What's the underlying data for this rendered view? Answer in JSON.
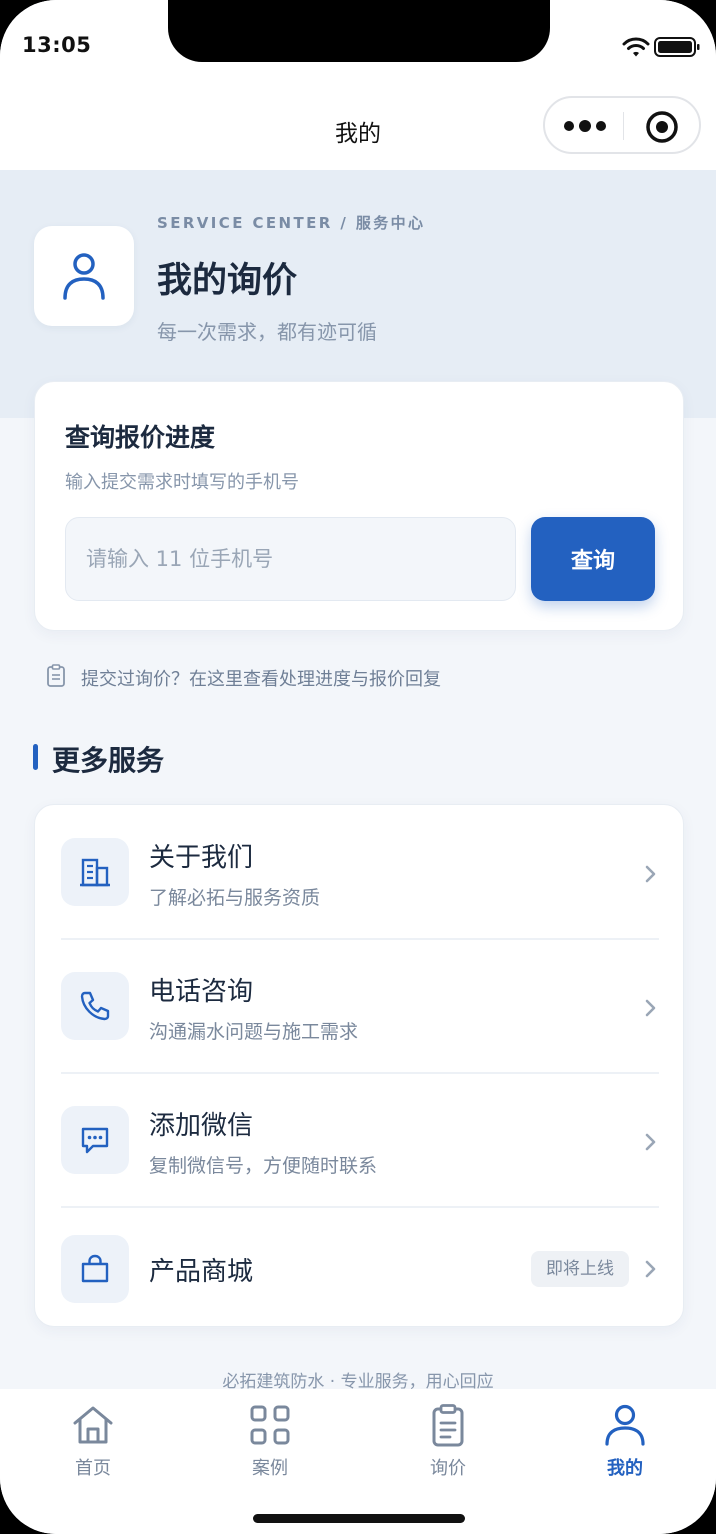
{
  "status_bar": {
    "time": "13:05"
  },
  "nav": {
    "title": "我的"
  },
  "header": {
    "eyebrow": "SERVICE CENTER / 服务中心",
    "title": "我的询价",
    "subtitle": "每一次需求，都有迹可循"
  },
  "query": {
    "title": "查询报价进度",
    "hint": "输入提交需求时填写的手机号",
    "input_placeholder": "请输入 11 位手机号",
    "input_value": "",
    "button_label": "查询"
  },
  "tip": {
    "text": "提交过询价？在这里查看处理进度与报价回复"
  },
  "more_services": {
    "title": "更多服务",
    "items": [
      {
        "title": "关于我们",
        "desc": "了解必拓与服务资质",
        "icon": "building-icon"
      },
      {
        "title": "电话咨询",
        "desc": "沟通漏水问题与施工需求",
        "icon": "phone-icon"
      },
      {
        "title": "添加微信",
        "desc": "复制微信号，方便随时联系",
        "icon": "chat-icon"
      },
      {
        "title": "产品商城",
        "badge": "即将上线",
        "icon": "shopping-bag-icon"
      }
    ]
  },
  "footer": {
    "text": "必拓建筑防水 · 专业服务，用心回应"
  },
  "tab_bar": {
    "items": [
      {
        "label": "首页",
        "icon": "home-icon",
        "active": false
      },
      {
        "label": "案例",
        "icon": "grid-icon",
        "active": false
      },
      {
        "label": "询价",
        "icon": "clipboard-icon",
        "active": false
      },
      {
        "label": "我的",
        "icon": "user-icon",
        "active": true
      }
    ]
  },
  "colors": {
    "accent": "#2361c0",
    "header_band": "#e6edf5",
    "page_background": "#f3f6fa",
    "text_primary": "#1c2a3f",
    "text_secondary": "#8796ab"
  }
}
